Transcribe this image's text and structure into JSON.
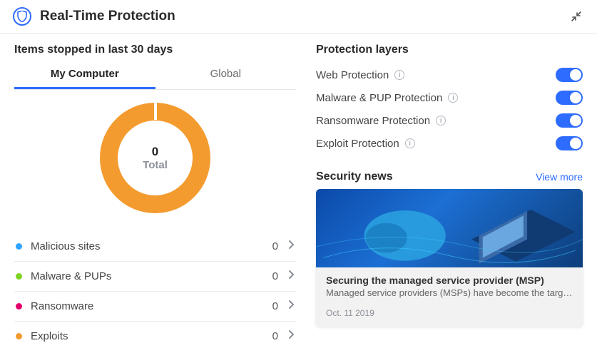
{
  "header": {
    "title": "Real-Time Protection"
  },
  "stopped": {
    "title": "Items stopped in last 30 days",
    "tabs": {
      "my": "My Computer",
      "global": "Global"
    },
    "total_value": "0",
    "total_label": "Total",
    "categories": [
      {
        "label": "Malicious sites",
        "count": "0",
        "color": "blue"
      },
      {
        "label": "Malware & PUPs",
        "count": "0",
        "color": "green"
      },
      {
        "label": "Ransomware",
        "count": "0",
        "color": "pink"
      },
      {
        "label": "Exploits",
        "count": "0",
        "color": "orange"
      }
    ]
  },
  "layers": {
    "title": "Protection layers",
    "items": [
      {
        "label": "Web Protection",
        "on": true
      },
      {
        "label": "Malware & PUP Protection",
        "on": true
      },
      {
        "label": "Ransomware Protection",
        "on": true
      },
      {
        "label": "Exploit Protection",
        "on": true
      }
    ]
  },
  "news": {
    "title": "Security news",
    "view_more": "View more",
    "card": {
      "title": "Securing the managed service provider (MSP)",
      "desc": "Managed service providers (MSPs) have become the targ…",
      "date": "Oct. 11 2019"
    }
  },
  "chart_data": {
    "type": "pie",
    "title": "Items stopped in last 30 days",
    "categories": [
      "Malicious sites",
      "Malware & PUPs",
      "Ransomware",
      "Exploits"
    ],
    "values": [
      0,
      0,
      0,
      0
    ],
    "total": 0
  }
}
